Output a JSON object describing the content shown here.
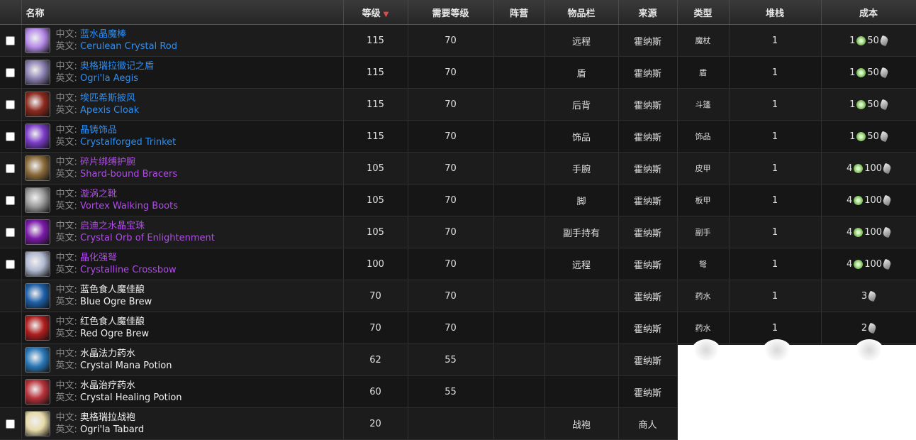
{
  "headers": {
    "name": "名称",
    "level": "等级",
    "req_level": "需要等级",
    "faction": "阵营",
    "slot": "物品栏",
    "source": "来源",
    "type": "类型",
    "stack": "堆栈",
    "cost": "成本"
  },
  "prefix": {
    "cn": "中文:",
    "en": "英文:"
  },
  "rows": [
    {
      "checkbox": true,
      "icon": "crystal-rod-icon",
      "icon_color": "#b58be8",
      "cn": "蓝水晶魔棒",
      "en": "Cerulean Crystal Rod",
      "quality": "rare",
      "level": "115",
      "req": "70",
      "faction": "",
      "slot": "远程",
      "source": "霍纳斯",
      "type": "魔杖",
      "stack": "1",
      "cost_a": "1",
      "cost_b": "50"
    },
    {
      "checkbox": true,
      "icon": "shield-icon",
      "icon_color": "#8a7fb0",
      "cn": "奥格瑞拉徽记之盾",
      "en": "Ogri'la Aegis",
      "quality": "rare",
      "level": "115",
      "req": "70",
      "faction": "",
      "slot": "盾",
      "source": "霍纳斯",
      "type": "盾",
      "stack": "1",
      "cost_a": "1",
      "cost_b": "50"
    },
    {
      "checkbox": true,
      "icon": "cloak-icon",
      "icon_color": "#8c2a1e",
      "cn": "埃匹希斯披风",
      "en": "Apexis Cloak",
      "quality": "rare",
      "level": "115",
      "req": "70",
      "faction": "",
      "slot": "后背",
      "source": "霍纳斯",
      "type": "斗篷",
      "stack": "1",
      "cost_a": "1",
      "cost_b": "50"
    },
    {
      "checkbox": true,
      "icon": "trinket-icon",
      "icon_color": "#7a3cc8",
      "cn": "晶铸饰品",
      "en": "Crystalforged Trinket",
      "quality": "rare",
      "level": "115",
      "req": "70",
      "faction": "",
      "slot": "饰品",
      "source": "霍纳斯",
      "type": "饰品",
      "stack": "1",
      "cost_a": "1",
      "cost_b": "50"
    },
    {
      "checkbox": true,
      "icon": "bracers-icon",
      "icon_color": "#8a6a3a",
      "cn": "碎片绑缚护腕",
      "en": "Shard-bound Bracers",
      "quality": "epic",
      "level": "105",
      "req": "70",
      "faction": "",
      "slot": "手腕",
      "source": "霍纳斯",
      "type": "皮甲",
      "stack": "1",
      "cost_a": "4",
      "cost_b": "100"
    },
    {
      "checkbox": true,
      "icon": "boots-icon",
      "icon_color": "#9a9a9a",
      "cn": "漩涡之靴",
      "en": "Vortex Walking Boots",
      "quality": "epic",
      "level": "105",
      "req": "70",
      "faction": "",
      "slot": "脚",
      "source": "霍纳斯",
      "type": "板甲",
      "stack": "1",
      "cost_a": "4",
      "cost_b": "100"
    },
    {
      "checkbox": true,
      "icon": "orb-icon",
      "icon_color": "#7a1aa8",
      "cn": "启迪之水晶宝珠",
      "en": "Crystal Orb of Enlightenment",
      "quality": "epic",
      "level": "105",
      "req": "70",
      "faction": "",
      "slot": "副手持有",
      "source": "霍纳斯",
      "type": "副手",
      "stack": "1",
      "cost_a": "4",
      "cost_b": "100"
    },
    {
      "checkbox": true,
      "icon": "crossbow-icon",
      "icon_color": "#b0b8d0",
      "cn": "晶化强弩",
      "en": "Crystalline Crossbow",
      "quality": "epic",
      "level": "100",
      "req": "70",
      "faction": "",
      "slot": "远程",
      "source": "霍纳斯",
      "type": "弩",
      "stack": "1",
      "cost_a": "4",
      "cost_b": "100"
    },
    {
      "checkbox": false,
      "icon": "blue-potion-icon",
      "icon_color": "#1d5fa8",
      "cn": "蓝色食人魔佳酿",
      "en": "Blue Ogre Brew",
      "quality": "common",
      "level": "70",
      "req": "70",
      "faction": "",
      "slot": "",
      "source": "霍纳斯",
      "type": "药水",
      "stack": "1",
      "cost_a": "",
      "cost_b": "3"
    },
    {
      "checkbox": false,
      "icon": "red-potion-icon",
      "icon_color": "#b01e1e",
      "cn": "红色食人魔佳酿",
      "en": "Red Ogre Brew",
      "quality": "common",
      "level": "70",
      "req": "70",
      "faction": "",
      "slot": "",
      "source": "霍纳斯",
      "type": "药水",
      "stack": "1",
      "cost_a": "",
      "cost_b": "2"
    },
    {
      "checkbox": false,
      "icon": "mana-potion-icon",
      "icon_color": "#2a78b8",
      "cn": "水晶法力药水",
      "en": "Crystal Mana Potion",
      "quality": "common",
      "level": "62",
      "req": "55",
      "faction": "",
      "slot": "",
      "source": "霍纳斯",
      "type": "",
      "stack": "",
      "cost_a": "",
      "cost_b": ""
    },
    {
      "checkbox": false,
      "icon": "healing-potion-icon",
      "icon_color": "#b8323a",
      "cn": "水晶治疗药水",
      "en": "Crystal Healing Potion",
      "quality": "common",
      "level": "60",
      "req": "55",
      "faction": "",
      "slot": "",
      "source": "霍纳斯",
      "type": "",
      "stack": "",
      "cost_a": "",
      "cost_b": ""
    },
    {
      "checkbox": true,
      "icon": "tabard-icon",
      "icon_color": "#e6d9a8",
      "cn": "奥格瑞拉战袍",
      "en": "Ogri'la Tabard",
      "quality": "common",
      "level": "20",
      "req": "",
      "faction": "",
      "slot": "战袍",
      "source": "商人",
      "type": "",
      "stack": "",
      "cost_a": "",
      "cost_b": ""
    }
  ]
}
